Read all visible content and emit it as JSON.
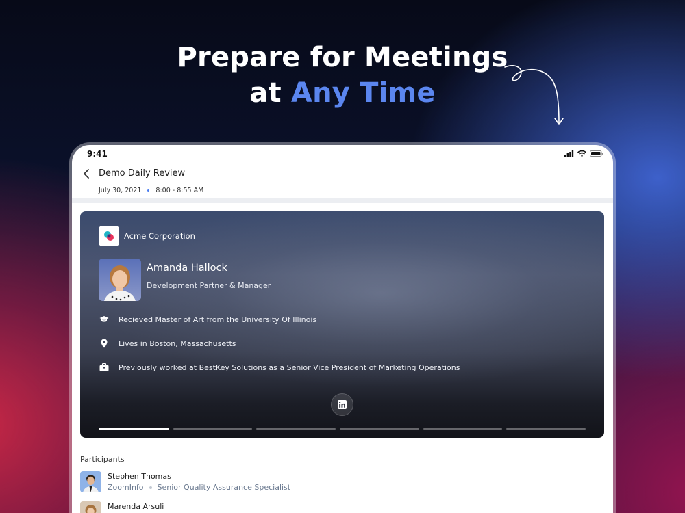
{
  "headline": {
    "line1": "Prepare for Meetings",
    "line2_prefix": "at",
    "line2_accent": "Any Time"
  },
  "colors": {
    "accent": "#5b86ef",
    "meta_dot": "#4a7df0"
  },
  "status_bar": {
    "time": "9:41",
    "icons": [
      "signal-icon",
      "wifi-icon",
      "battery-icon"
    ]
  },
  "meeting": {
    "title": "Demo Daily Review",
    "date": "July 30, 2021",
    "time_range": "8:00 - 8:55 AM"
  },
  "card": {
    "company": "Acme Corporation",
    "person_name": "Amanda Hallock",
    "person_role": "Development Partner & Manager",
    "facts": [
      {
        "icon": "graduation-cap-icon",
        "text": "Recieved Master of Art from the University Of Illinois"
      },
      {
        "icon": "location-pin-icon",
        "text": "Lives in Boston, Massachusetts"
      },
      {
        "icon": "briefcase-icon",
        "text": "Previously worked at BestKey Solutions as a Senior Vice President of Marketing Operations"
      }
    ],
    "social": "linkedin-icon",
    "progress": {
      "segments": 6,
      "active_index": 0
    }
  },
  "participants": {
    "title": "Participants",
    "items": [
      {
        "name": "Stephen Thomas",
        "company": "ZoomInfo",
        "role": "Senior Quality Assurance Specialist"
      },
      {
        "name": "Marenda Arsuli",
        "company": "",
        "role": ""
      }
    ]
  }
}
